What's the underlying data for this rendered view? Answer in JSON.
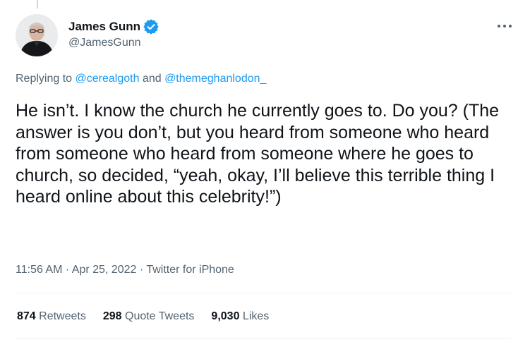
{
  "tweet": {
    "display_name": "James Gunn",
    "handle": "@JamesGunn",
    "verified": true,
    "reply_prefix": "Replying to ",
    "reply_user_1": "@cerealgoth",
    "reply_and": " and ",
    "reply_user_2": "@themeghanlodon_",
    "text": "He isn’t. I know the church he currently goes to. Do you? (The answer is you don’t, but you heard from someone who heard from someone who heard from someone where he goes to church, so decided, “yeah, okay, I’ll believe this terrible thing I heard online about this celebrity!”)",
    "time": "11:56 AM",
    "date": "Apr 25, 2022",
    "source": "Twitter for iPhone",
    "separator": " · "
  },
  "stats": {
    "retweets_count": "874",
    "retweets_label": " Retweets",
    "quotes_count": "298",
    "quotes_label": " Quote Tweets",
    "likes_count": "9,030",
    "likes_label": " Likes"
  },
  "colors": {
    "link": "#1d9bf0",
    "secondary_text": "#536471",
    "primary_text": "#0f1419",
    "divider": "#eff3f4"
  },
  "icons": {
    "verified": "verified-badge-icon",
    "more": "more-options-icon"
  }
}
